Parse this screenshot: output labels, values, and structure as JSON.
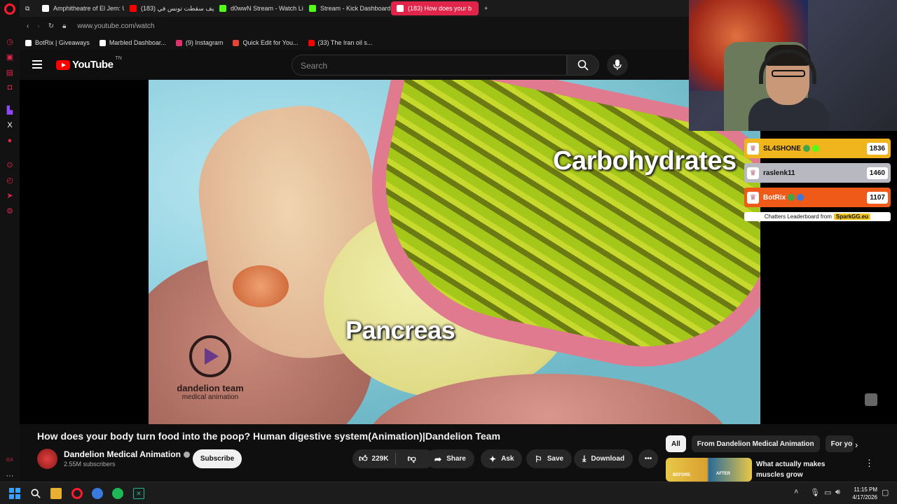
{
  "browser": {
    "tabs": [
      {
        "label": "Amphitheatre of El Jem: U",
        "color": "#ffffff",
        "active": false
      },
      {
        "label": "كيف سقطت تونس في (183)",
        "color": "#ff0000",
        "active": false
      },
      {
        "label": "d0wwN Stream - Watch Li",
        "color": "#53fc18",
        "active": false
      },
      {
        "label": "Stream - Kick Dashboard",
        "color": "#53fc18",
        "active": false
      },
      {
        "label": "(183) How does your b",
        "color": "#ffffff",
        "active": true
      }
    ],
    "new_tab_label": "+",
    "url": "www.youtube.com/watch",
    "bookmarks": [
      {
        "label": "BotRix | Giveaways",
        "color": "#ffffff"
      },
      {
        "label": "Marbled Dashboar...",
        "color": "#ffffff"
      },
      {
        "label": "(9) Instagram",
        "color": "#e1306c"
      },
      {
        "label": "Quick Edit for You...",
        "color": "#ea4335"
      },
      {
        "label": "(33) The Iran oil s...",
        "color": "#ff0000"
      }
    ]
  },
  "youtube": {
    "logo_text": "YouTube",
    "logo_region": "TN",
    "search_placeholder": "Search"
  },
  "video": {
    "label_carbohydrates": "Carbohydrates",
    "label_pancreas": "Pancreas",
    "watermark_line1": "dandelion team",
    "watermark_line2": "medical animation",
    "title": "How does your body turn food into the poop? Human digestive system(Animation)|Dandelion Team"
  },
  "leaderboard": {
    "rows": [
      {
        "name": "SL4SHONE",
        "points": "1836"
      },
      {
        "name": "raslenk11",
        "points": "1460"
      },
      {
        "name": "BotRix",
        "points": "1107"
      }
    ],
    "footer_text": "Chatters Leaderboard from",
    "footer_brand": "SparkGG.eu"
  },
  "channel": {
    "name": "Dandelion Medical Animation",
    "subscribers": "2.55M subscribers",
    "subscribe_label": "Subscribe"
  },
  "actions": {
    "likes": "229K",
    "share": "Share",
    "ask": "Ask",
    "save": "Save",
    "download": "Download",
    "more": "•••"
  },
  "sidebar_right": {
    "chips": [
      "All",
      "From Dandelion Medical Animation",
      "For yo"
    ],
    "recommendation_title": "What actually makes muscles grow",
    "thumb_labels": [
      "BEFORE",
      "AFTER"
    ]
  },
  "taskbar": {
    "time": "11:15 PM",
    "date": "4/17/2026"
  },
  "colors": {
    "accent": "#e0244a",
    "youtube_red": "#ff0000"
  }
}
